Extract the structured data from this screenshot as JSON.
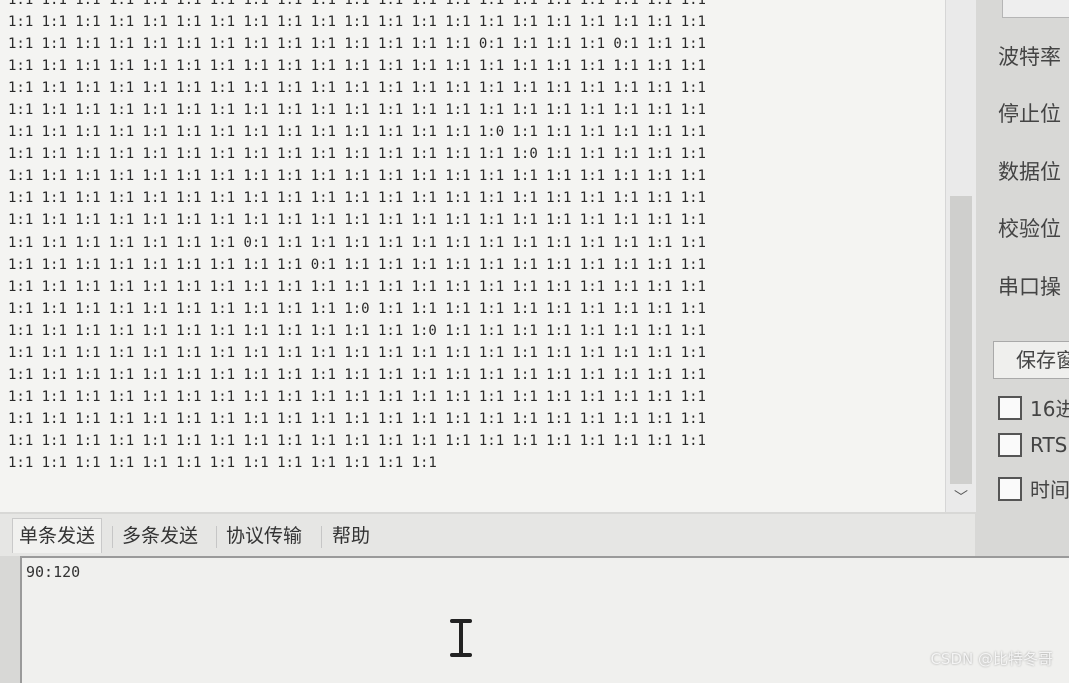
{
  "receive": {
    "lines": [
      "1:1 1:1 1:1 1:1 1:1 1:1 1:1 1:1 1:1 1:1 1:1 1:1 1:1 1:1 1:1 1:1 1:1 1:1 1:1 1:1 1:1",
      "1:1 1:1 1:1 1:1 1:1 1:1 1:1 1:1 1:1 1:1 1:1 1:1 1:1 1:1 1:1 1:1 1:1 1:1 1:1 1:1 1:1",
      "1:1 1:1 1:1 1:1 1:1 1:1 1:1 1:1 1:1 1:1 1:1 1:1 1:1 1:1 0:1 1:1 1:1 1:1 0:1 1:1 1:1",
      "1:1 1:1 1:1 1:1 1:1 1:1 1:1 1:1 1:1 1:1 1:1 1:1 1:1 1:1 1:1 1:1 1:1 1:1 1:1 1:1 1:1",
      "1:1 1:1 1:1 1:1 1:1 1:1 1:1 1:1 1:1 1:1 1:1 1:1 1:1 1:1 1:1 1:1 1:1 1:1 1:1 1:1 1:1",
      "1:1 1:1 1:1 1:1 1:1 1:1 1:1 1:1 1:1 1:1 1:1 1:1 1:1 1:1 1:1 1:1 1:1 1:1 1:1 1:1 1:1",
      "1:1 1:1 1:1 1:1 1:1 1:1 1:1 1:1 1:1 1:1 1:1 1:1 1:1 1:1 1:0 1:1 1:1 1:1 1:1 1:1 1:1",
      "1:1 1:1 1:1 1:1 1:1 1:1 1:1 1:1 1:1 1:1 1:1 1:1 1:1 1:1 1:1 1:0 1:1 1:1 1:1 1:1 1:1",
      "1:1 1:1 1:1 1:1 1:1 1:1 1:1 1:1 1:1 1:1 1:1 1:1 1:1 1:1 1:1 1:1 1:1 1:1 1:1 1:1 1:1",
      "1:1 1:1 1:1 1:1 1:1 1:1 1:1 1:1 1:1 1:1 1:1 1:1 1:1 1:1 1:1 1:1 1:1 1:1 1:1 1:1 1:1",
      "1:1 1:1 1:1 1:1 1:1 1:1 1:1 1:1 1:1 1:1 1:1 1:1 1:1 1:1 1:1 1:1 1:1 1:1 1:1 1:1 1:1",
      "1:1 1:1 1:1 1:1 1:1 1:1 1:1 0:1 1:1 1:1 1:1 1:1 1:1 1:1 1:1 1:1 1:1 1:1 1:1 1:1 1:1",
      "1:1 1:1 1:1 1:1 1:1 1:1 1:1 1:1 1:1 0:1 1:1 1:1 1:1 1:1 1:1 1:1 1:1 1:1 1:1 1:1 1:1",
      "1:1 1:1 1:1 1:1 1:1 1:1 1:1 1:1 1:1 1:1 1:1 1:1 1:1 1:1 1:1 1:1 1:1 1:1 1:1 1:1 1:1",
      "1:1 1:1 1:1 1:1 1:1 1:1 1:1 1:1 1:1 1:1 1:0 1:1 1:1 1:1 1:1 1:1 1:1 1:1 1:1 1:1 1:1",
      "1:1 1:1 1:1 1:1 1:1 1:1 1:1 1:1 1:1 1:1 1:1 1:1 1:0 1:1 1:1 1:1 1:1 1:1 1:1 1:1 1:1",
      "1:1 1:1 1:1 1:1 1:1 1:1 1:1 1:1 1:1 1:1 1:1 1:1 1:1 1:1 1:1 1:1 1:1 1:1 1:1 1:1 1:1",
      "1:1 1:1 1:1 1:1 1:1 1:1 1:1 1:1 1:1 1:1 1:1 1:1 1:1 1:1 1:1 1:1 1:1 1:1 1:1 1:1 1:1",
      "1:1 1:1 1:1 1:1 1:1 1:1 1:1 1:1 1:1 1:1 1:1 1:1 1:1 1:1 1:1 1:1 1:1 1:1 1:1 1:1 1:1",
      "1:1 1:1 1:1 1:1 1:1 1:1 1:1 1:1 1:1 1:1 1:1 1:1 1:1 1:1 1:1 1:1 1:1 1:1 1:1 1:1 1:1",
      "1:1 1:1 1:1 1:1 1:1 1:1 1:1 1:1 1:1 1:1 1:1 1:1 1:1 1:1 1:1 1:1 1:1 1:1 1:1 1:1 1:1",
      "1:1 1:1 1:1 1:1 1:1 1:1 1:1 1:1 1:1 1:1 1:1 1:1 1:1"
    ]
  },
  "scrollbar": {
    "down_icon": "chevron-down-icon",
    "down_glyph": "﹀"
  },
  "tabs": [
    {
      "label": "单条发送",
      "active": true
    },
    {
      "label": "多条发送",
      "active": false
    },
    {
      "label": "协议传输",
      "active": false
    },
    {
      "label": "帮助",
      "active": false
    }
  ],
  "send": {
    "text": "90:120"
  },
  "settings": {
    "baud_label": "波特率",
    "stop_bits_label": "停止位",
    "data_bits_label": "数据位",
    "parity_label": "校验位",
    "port_op_label": "串口操"
  },
  "save_button": {
    "label": "保存窗"
  },
  "checkboxes": [
    {
      "label": "16进",
      "checked": false
    },
    {
      "label": "RTS",
      "checked": false
    },
    {
      "label": "时间",
      "checked": false
    }
  ],
  "watermark": "CSDN @比特冬哥",
  "colors": {
    "panel": "#f4f4f2",
    "frame": "#d8d8d6",
    "text": "#2a2a2a"
  }
}
